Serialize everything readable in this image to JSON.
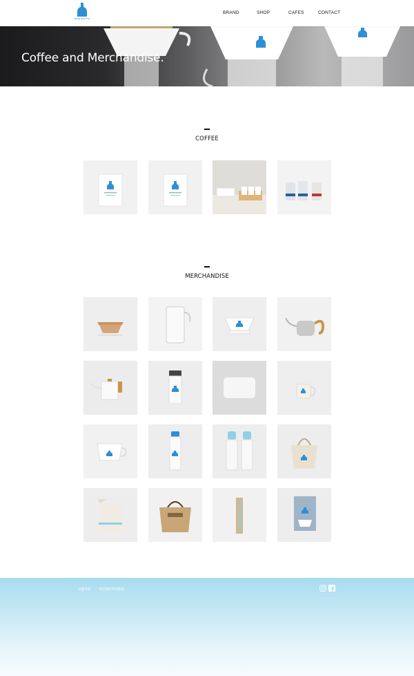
{
  "header": {
    "logo_alt": "Blue Bottle Coffee",
    "logo_text": "BLUE BOTTLE",
    "nav": {
      "brand": "BRAND",
      "shop": "SHOP",
      "cafes": "CAFES",
      "contact": "CONTACT"
    }
  },
  "hero": {
    "title": "Coffee and Merchandise."
  },
  "sections": {
    "coffee": "COFFEE",
    "merchandise": "MERCHANDISE"
  },
  "coffee_products": [
    {
      "icon": "coffee-bag-icon"
    },
    {
      "icon": "coffee-bag-icon"
    },
    {
      "icon": "coffee-gift-box-icon"
    },
    {
      "icon": "cold-brew-cans-icon"
    }
  ],
  "merchandise_products": [
    {
      "icon": "paper-filters-icon"
    },
    {
      "icon": "glass-carafe-icon"
    },
    {
      "icon": "dripper-icon"
    },
    {
      "icon": "pour-over-kettle-icon"
    },
    {
      "icon": "white-kettle-icon"
    },
    {
      "icon": "travel-tumbler-icon"
    },
    {
      "icon": "coffee-scale-icon"
    },
    {
      "icon": "mug-icon"
    },
    {
      "icon": "cup-icon"
    },
    {
      "icon": "water-bottle-icon"
    },
    {
      "icon": "cold-brew-bottles-icon"
    },
    {
      "icon": "canvas-tote-icon"
    },
    {
      "icon": "grocery-bag-icon"
    },
    {
      "icon": "jute-tote-icon"
    },
    {
      "icon": "straw-set-icon"
    },
    {
      "icon": "book-icon"
    }
  ],
  "footer": {
    "terms": "이용약관",
    "privacy": "개인정보처리방침",
    "social": [
      "instagram-icon",
      "facebook-icon"
    ]
  },
  "colors": {
    "brand_blue": "#2d8fd5",
    "footer_gradient_top": "#a8dcf0"
  }
}
